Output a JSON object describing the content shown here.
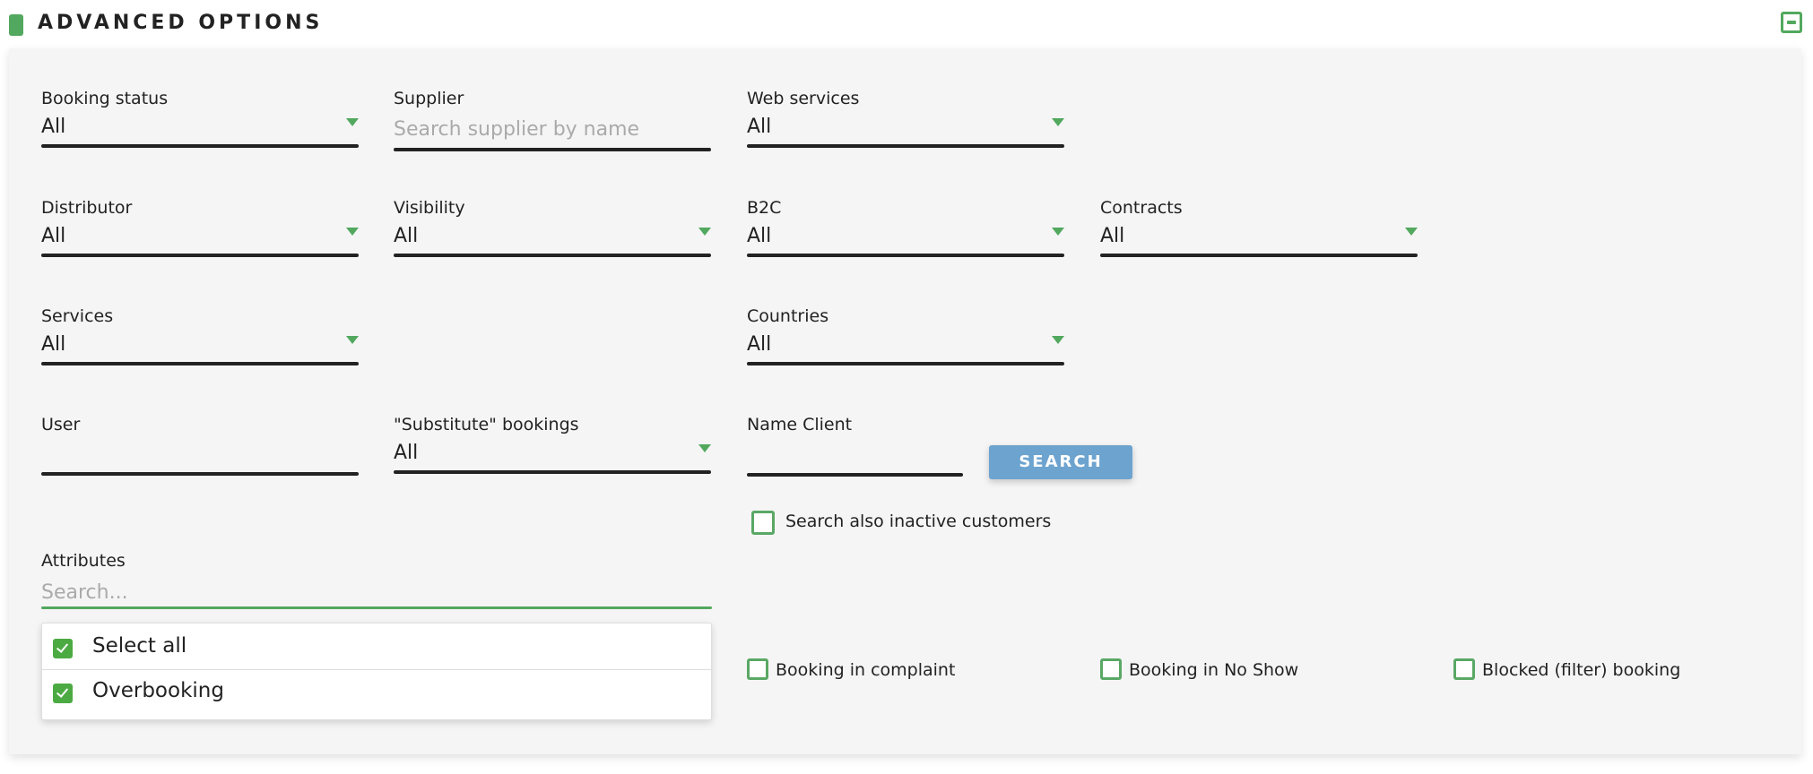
{
  "header": {
    "title": "ADVANCED OPTIONS",
    "collapse_icon": "minus-square-icon"
  },
  "fields": {
    "booking_status": {
      "label": "Booking status",
      "value": "All"
    },
    "supplier": {
      "label": "Supplier",
      "placeholder": "Search supplier by name",
      "value": ""
    },
    "web_services": {
      "label": "Web services",
      "value": "All"
    },
    "distributor": {
      "label": "Distributor",
      "value": "All"
    },
    "visibility": {
      "label": "Visibility",
      "value": "All"
    },
    "b2c": {
      "label": "B2C",
      "value": "All"
    },
    "contracts": {
      "label": "Contracts",
      "value": "All"
    },
    "services": {
      "label": "Services",
      "value": "All"
    },
    "countries": {
      "label": "Countries",
      "value": "All"
    },
    "user": {
      "label": "User",
      "value": ""
    },
    "substitute_bookings": {
      "label": "\"Substitute\" bookings",
      "value": "All"
    },
    "name_client": {
      "label": "Name Client",
      "value": ""
    },
    "attributes": {
      "label": "Attributes",
      "placeholder": "Search...",
      "value": ""
    }
  },
  "search_button": {
    "label": "SEARCH"
  },
  "checkboxes": {
    "inactive_customers": {
      "label": "Search also inactive customers",
      "checked": false
    },
    "booking_in_complaint": {
      "label": "Booking in complaint",
      "checked": false
    },
    "booking_in_no_show": {
      "label": "Booking in No Show",
      "checked": false
    },
    "blocked_booking": {
      "label": "Blocked (filter) booking",
      "checked": false
    }
  },
  "attributes_dropdown": {
    "items": [
      {
        "label": "Select all",
        "checked": true
      },
      {
        "label": "Overbooking",
        "checked": true
      }
    ]
  },
  "colors": {
    "accent": "#52a85e",
    "button": "#6da3cf",
    "panel_bg": "#f5f5f5"
  }
}
